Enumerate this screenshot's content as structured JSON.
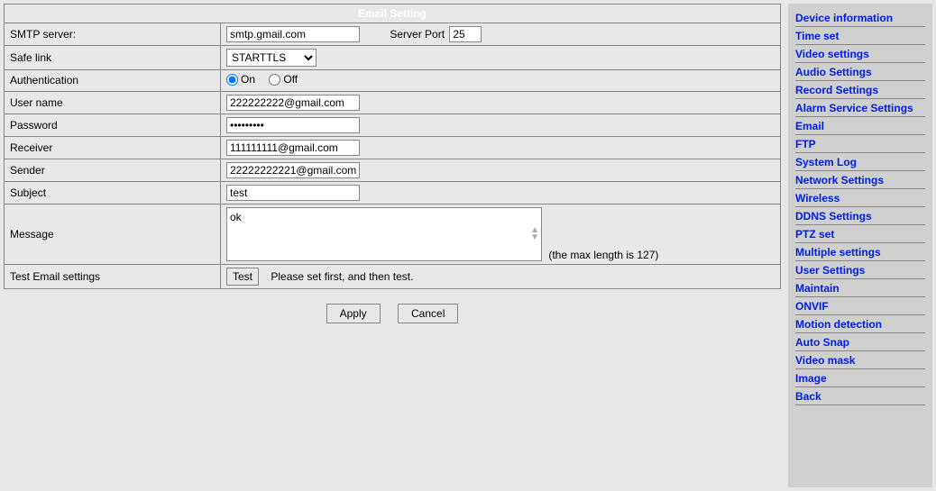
{
  "header": {
    "title": "Email Setting"
  },
  "form": {
    "smtp_label": "SMTP server:",
    "smtp_value": "smtp.gmail.com",
    "server_port_label": "Server Port",
    "server_port_value": "25",
    "safe_link_label": "Safe link",
    "safe_link_value": "STARTTLS",
    "auth_label": "Authentication",
    "auth_on_label": "On",
    "auth_off_label": "Off",
    "username_label": "User name",
    "username_value": "222222222@gmail.com",
    "password_label": "Password",
    "password_value": "•••••••••",
    "receiver_label": "Receiver",
    "receiver_value": "111111111@gmail.com",
    "sender_label": "Sender",
    "sender_value": "22222222221@gmail.com",
    "subject_label": "Subject",
    "subject_value": "test",
    "message_label": "Message",
    "message_value": "ok",
    "message_hint": "(the max length is 127)",
    "test_label": "Test Email settings",
    "test_button": "Test",
    "test_hint": "Please set first, and then test."
  },
  "buttons": {
    "apply": "Apply",
    "cancel": "Cancel"
  },
  "sidebar": {
    "items": [
      {
        "label": "Device information"
      },
      {
        "label": "Time set"
      },
      {
        "label": "Video settings"
      },
      {
        "label": "Audio Settings"
      },
      {
        "label": "Record Settings"
      },
      {
        "label": "Alarm Service Settings"
      },
      {
        "label": "Email"
      },
      {
        "label": "FTP"
      },
      {
        "label": "System Log"
      },
      {
        "label": "Network Settings"
      },
      {
        "label": "Wireless"
      },
      {
        "label": "DDNS Settings"
      },
      {
        "label": "PTZ set"
      },
      {
        "label": "Multiple settings"
      },
      {
        "label": "User Settings"
      },
      {
        "label": "Maintain"
      },
      {
        "label": "ONVIF"
      },
      {
        "label": "Motion detection"
      },
      {
        "label": "Auto Snap"
      },
      {
        "label": "Video mask"
      },
      {
        "label": "Image"
      },
      {
        "label": "Back"
      }
    ]
  }
}
